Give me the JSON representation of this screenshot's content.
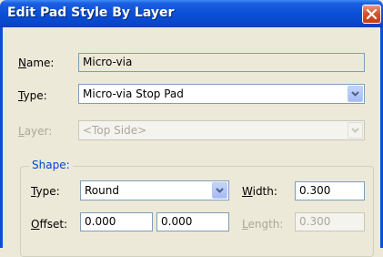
{
  "window": {
    "title": "Edit Pad Style By Layer",
    "close_icon": "close-icon"
  },
  "name": {
    "label_ul": "N",
    "label_rest": "ame:",
    "value": "Micro-via"
  },
  "type": {
    "label_ul": "T",
    "label_rest": "ype:",
    "value": "Micro-via Stop Pad"
  },
  "layer": {
    "label_ul": "L",
    "label_rest": "ayer:",
    "value": "<Top Side>"
  },
  "shape": {
    "title": "Shape:",
    "type": {
      "label_ul": "T",
      "label_rest": "ype:",
      "value": "Round"
    },
    "width": {
      "label_ul": "W",
      "label_rest": "idth:",
      "value": "0.300"
    },
    "offset": {
      "label_ul": "O",
      "label_rest": "ffset:",
      "x": "0.000",
      "y": "0.000"
    },
    "length": {
      "label_ul": "L",
      "label_rest": "ength:",
      "value": "0.300"
    }
  },
  "colors": {
    "titlebar": "#0a4fd8",
    "dialog_bg": "#ece9d8",
    "group_title": "#0046d5",
    "close": "#d8542d"
  }
}
